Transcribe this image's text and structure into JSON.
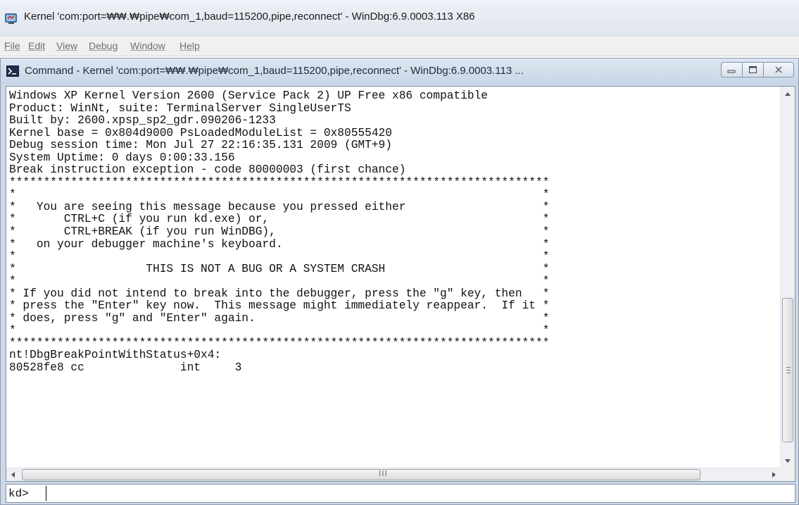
{
  "app": {
    "title": "Kernel 'com:port=₩₩.₩pipe₩com_1,baud=115200,pipe,reconnect' - WinDbg:6.9.0003.113 X86"
  },
  "menu": [
    {
      "label": "File"
    },
    {
      "label": "Edit"
    },
    {
      "label": "View"
    },
    {
      "label": "Debug"
    },
    {
      "label": "Window"
    },
    {
      "label": "Help"
    }
  ],
  "command_window": {
    "title": "Command - Kernel 'com:port=₩₩.₩pipe₩com_1,baud=115200,pipe,reconnect' - WinDbg:6.9.0003.113 ...",
    "output_lines": [
      "Windows XP Kernel Version 2600 (Service Pack 2) UP Free x86 compatible",
      "Product: WinNt, suite: TerminalServer SingleUserTS",
      "Built by: 2600.xpsp_sp2_gdr.090206-1233",
      "Kernel base = 0x804d9000 PsLoadedModuleList = 0x80555420",
      "Debug session time: Mon Jul 27 22:16:35.131 2009 (GMT+9)",
      "System Uptime: 0 days 0:00:33.156",
      "Break instruction exception - code 80000003 (first chance)",
      "*******************************************************************************",
      "*                                                                             *",
      "*   You are seeing this message because you pressed either                    *",
      "*       CTRL+C (if you run kd.exe) or,                                        *",
      "*       CTRL+BREAK (if you run WinDBG),                                       *",
      "*   on your debugger machine's keyboard.                                      *",
      "*                                                                             *",
      "*                   THIS IS NOT A BUG OR A SYSTEM CRASH                       *",
      "*                                                                             *",
      "* If you did not intend to break into the debugger, press the \"g\" key, then   *",
      "* press the \"Enter\" key now.  This message might immediately reappear.  If it *",
      "* does, press \"g\" and \"Enter\" again.                                          *",
      "*                                                                             *",
      "*******************************************************************************",
      "nt!DbgBreakPointWithStatus+0x4:",
      "80528fe8 cc              int     3"
    ],
    "scroll_grip": "III",
    "prompt": "kd>",
    "input_value": ""
  }
}
